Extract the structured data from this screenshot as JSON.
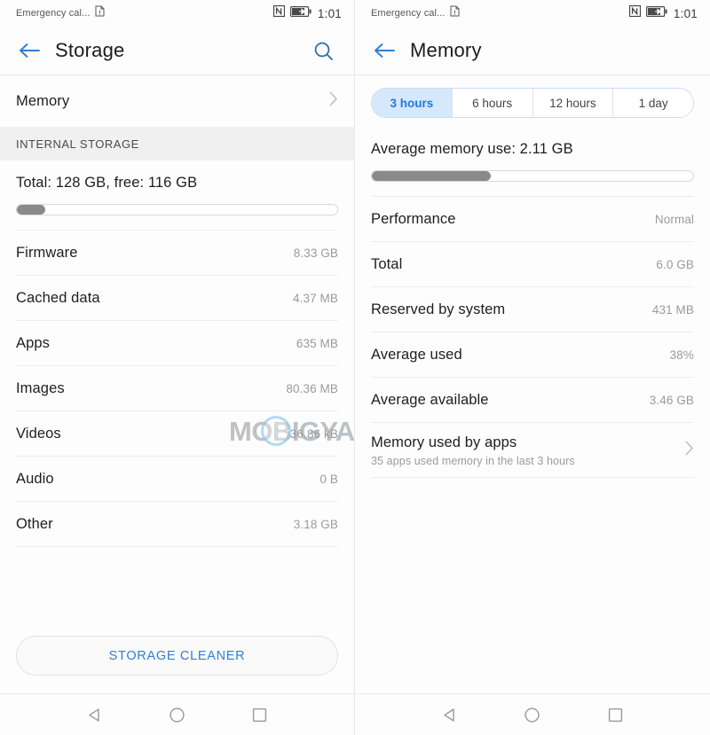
{
  "watermark": {
    "text": "MOBIGYAAN"
  },
  "left_screen": {
    "statusbar": {
      "carrier": "Emergency cal...",
      "sim_icon": "sim-card-icon",
      "nfc_icon": "nfc-icon",
      "battery_icon": "battery-charging-icon",
      "time": "1:01"
    },
    "titlebar": {
      "back_icon": "back-arrow-icon",
      "title": "Storage",
      "search_icon": "search-icon"
    },
    "memory_row": {
      "label": "Memory",
      "chevron_icon": "chevron-right-icon"
    },
    "section_header": "INTERNAL STORAGE",
    "total_text": "Total: 128 GB, free: 116 GB",
    "storage_bar": {
      "percent": 9
    },
    "items": [
      {
        "label": "Firmware",
        "value": "8.33 GB"
      },
      {
        "label": "Cached data",
        "value": "4.37 MB"
      },
      {
        "label": "Apps",
        "value": "635 MB"
      },
      {
        "label": "Images",
        "value": "80.36 MB"
      },
      {
        "label": "Videos",
        "value": "36.86 kB"
      },
      {
        "label": "Audio",
        "value": "0 B"
      },
      {
        "label": "Other",
        "value": "3.18 GB"
      }
    ],
    "cleaner_button": "STORAGE CLEANER",
    "navbar": {
      "back_icon": "nav-back-triangle-icon",
      "home_icon": "nav-home-circle-icon",
      "recents_icon": "nav-recents-square-icon"
    }
  },
  "right_screen": {
    "statusbar": {
      "carrier": "Emergency cal...",
      "sim_icon": "sim-card-icon",
      "nfc_icon": "nfc-icon",
      "battery_icon": "battery-charging-icon",
      "time": "1:01"
    },
    "titlebar": {
      "back_icon": "back-arrow-icon",
      "title": "Memory"
    },
    "tabs": [
      {
        "label": "3 hours",
        "active": true
      },
      {
        "label": "6 hours",
        "active": false
      },
      {
        "label": "12 hours",
        "active": false
      },
      {
        "label": "1 day",
        "active": false
      }
    ],
    "average_text": "Average memory use: 2.11 GB",
    "memory_bar": {
      "percent": 37
    },
    "items": [
      {
        "label": "Performance",
        "value": "Normal"
      },
      {
        "label": "Total",
        "value": "6.0 GB"
      },
      {
        "label": "Reserved by system",
        "value": "431 MB"
      },
      {
        "label": "Average used",
        "value": "38%"
      },
      {
        "label": "Average available",
        "value": "3.46 GB"
      }
    ],
    "apps_row": {
      "label": "Memory used by apps",
      "sub": "35 apps used memory in the last 3 hours",
      "chevron_icon": "chevron-right-icon"
    },
    "navbar": {
      "back_icon": "nav-back-triangle-icon",
      "home_icon": "nav-home-circle-icon",
      "recents_icon": "nav-recents-square-icon"
    }
  },
  "colors": {
    "accent": "#2f7fd4",
    "bar_fill": "#8a8a8a",
    "tab_active_bg": "#d6e8fb",
    "tab_active_text": "#1f7ae0"
  }
}
